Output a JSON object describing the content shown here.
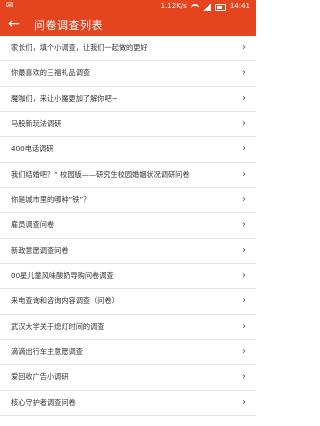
{
  "status": {
    "net_speed": "1.12K/s",
    "time": "14:41"
  },
  "appbar": {
    "title": "问卷调查列表",
    "back_icon": "back-arrow-icon"
  },
  "surveys": [
    "家长们，填个小调查，让我们一起做的更好",
    "你最喜欢的三福礼品调查",
    "魔咖们，来让小魔更加了解你吧~",
    "马股新玩法调研",
    "400电话调研",
    "我们结婚吧？” 校园版——研究生校园婚姻状况调研问卷",
    "你是城市里的哪种“铁”？",
    "雇员调查问卷",
    "新政意愿调查问卷",
    "00星儿童风味酸奶导购问卷调查",
    "来电查询和咨询内容调查（问卷）",
    "武汉大学关于熄灯时间的调查",
    "滴滴出行车主意愿调查",
    "爱回收广告小调研",
    "核心守护者调查问卷"
  ],
  "colors": {
    "accent": "#e4451f",
    "text": "#333333",
    "divider": "#e6e6e6"
  }
}
